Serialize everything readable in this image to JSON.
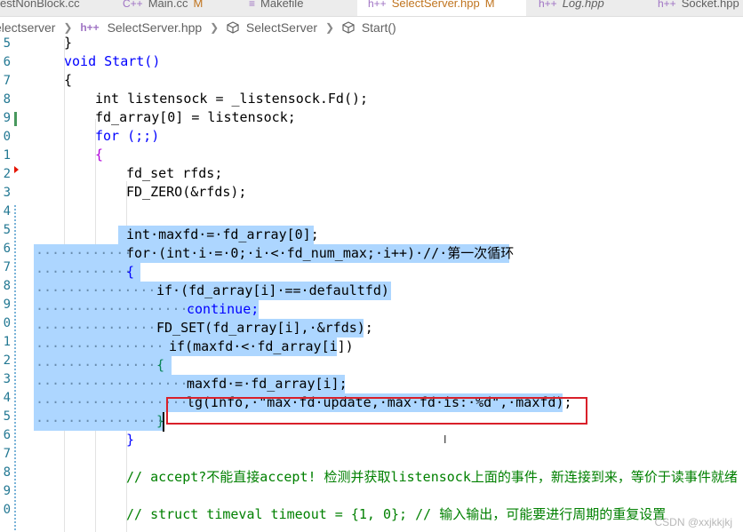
{
  "tabs": [
    {
      "label": "estNonBlock.cc",
      "icon": "",
      "modified": "",
      "active": false
    },
    {
      "label": "Main.cc",
      "icon": "C++",
      "modified": "M",
      "active": false
    },
    {
      "label": "Makefile",
      "icon": "",
      "modified": "",
      "active": false
    },
    {
      "label": "SelectServer.hpp",
      "icon": "h++",
      "modified": "M",
      "active": true
    },
    {
      "label": "Log.hpp",
      "icon": "h++",
      "modified": "",
      "active": false
    },
    {
      "label": "Socket.hpp",
      "icon": "h++",
      "modified": "",
      "active": false
    }
  ],
  "breadcrumb": {
    "folder": "electserver",
    "file_icon": "h++",
    "file": "SelectServer.hpp",
    "class_name": "SelectServer",
    "method": "Start()"
  },
  "line_numbers": [
    "5",
    "6",
    "7",
    "8",
    "9",
    "0",
    "1",
    "2",
    "3",
    "4",
    "5",
    "6",
    "7",
    "8",
    "9",
    "0",
    "1",
    "2",
    "3",
    "4",
    "5",
    "6",
    "7",
    "8",
    "9",
    "0"
  ],
  "code": {
    "l00": "}",
    "l01": "void Start()",
    "l02": "{",
    "l03": "int listensock = _listensock.Fd();",
    "l04": "fd_array[0] = listensock;",
    "l05": "for (;;)",
    "l06": "{",
    "l07": "fd_set rfds;",
    "l08": "FD_ZERO(&rfds);",
    "l10": "int·maxfd·=·fd_array[0];",
    "l11": "for·(int·i·=·0;·i·<·fd_num_max;·i++)·//·第一次循环",
    "l12": "{",
    "l13": "if·(fd_array[i]·==·defaultfd)",
    "l14": "continue;",
    "l15": "FD_SET(fd_array[i],·&rfds);",
    "l16": "if(maxfd·<·fd_array[i])",
    "l17": "{",
    "l18": "maxfd·=·fd_array[i];",
    "l19": "lg(Info,·\"max·fd·update,·max·fd·is:·%d\",·maxfd);",
    "l20": "}",
    "l21": "}",
    "l23": "// accept?不能直接accept! 检测并获取listensock上面的事件，新连接到来，等价于读事件就绪",
    "l25": "// struct timeval timeout = {1, 0}; // 输入输出，可能要进行周期的重复设置"
  },
  "watermark": "CSDN @xxjkkjkj",
  "colors": {
    "selection": "#add6ff",
    "keyword": "#0000ff",
    "string": "#a31515",
    "comment": "#008000",
    "number": "#098658",
    "highlight_box": "#d9202a",
    "line_number": "#237893",
    "git_added": "#48985d"
  }
}
